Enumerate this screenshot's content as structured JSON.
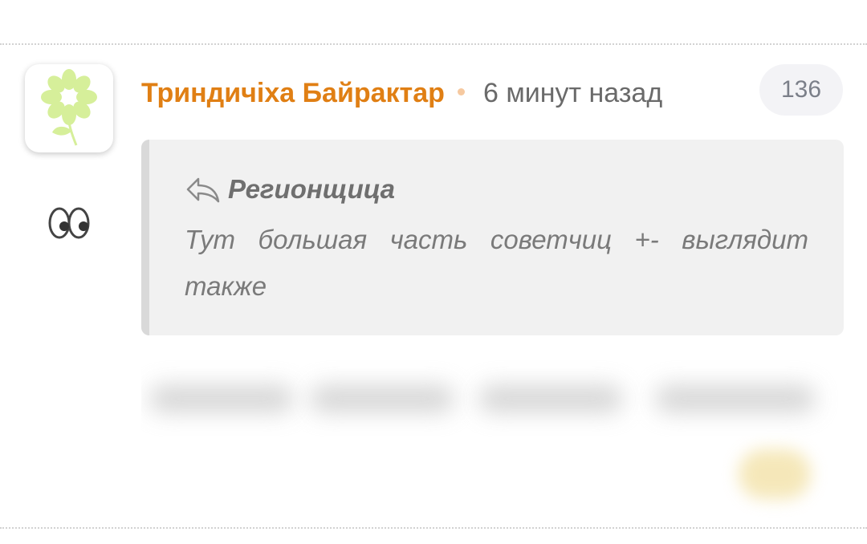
{
  "comment": {
    "author": "Триндичіха Байрактар",
    "timestamp": "6 минут назад",
    "counter": "136",
    "status_emoji": "eyes-icon",
    "avatar_icon": "flower-icon",
    "quote": {
      "icon": "reply-arrow-icon",
      "author": "Регионщица",
      "text": "Тут большая часть советчиц +- выглядит также"
    }
  },
  "colors": {
    "author": "#e07f14",
    "timestamp": "#6a6a6a",
    "quote_bg": "#f1f1f1",
    "quote_bar": "#d9d9d9",
    "counter_bg": "#f3f3f6",
    "flower": "#d6ef9a"
  }
}
